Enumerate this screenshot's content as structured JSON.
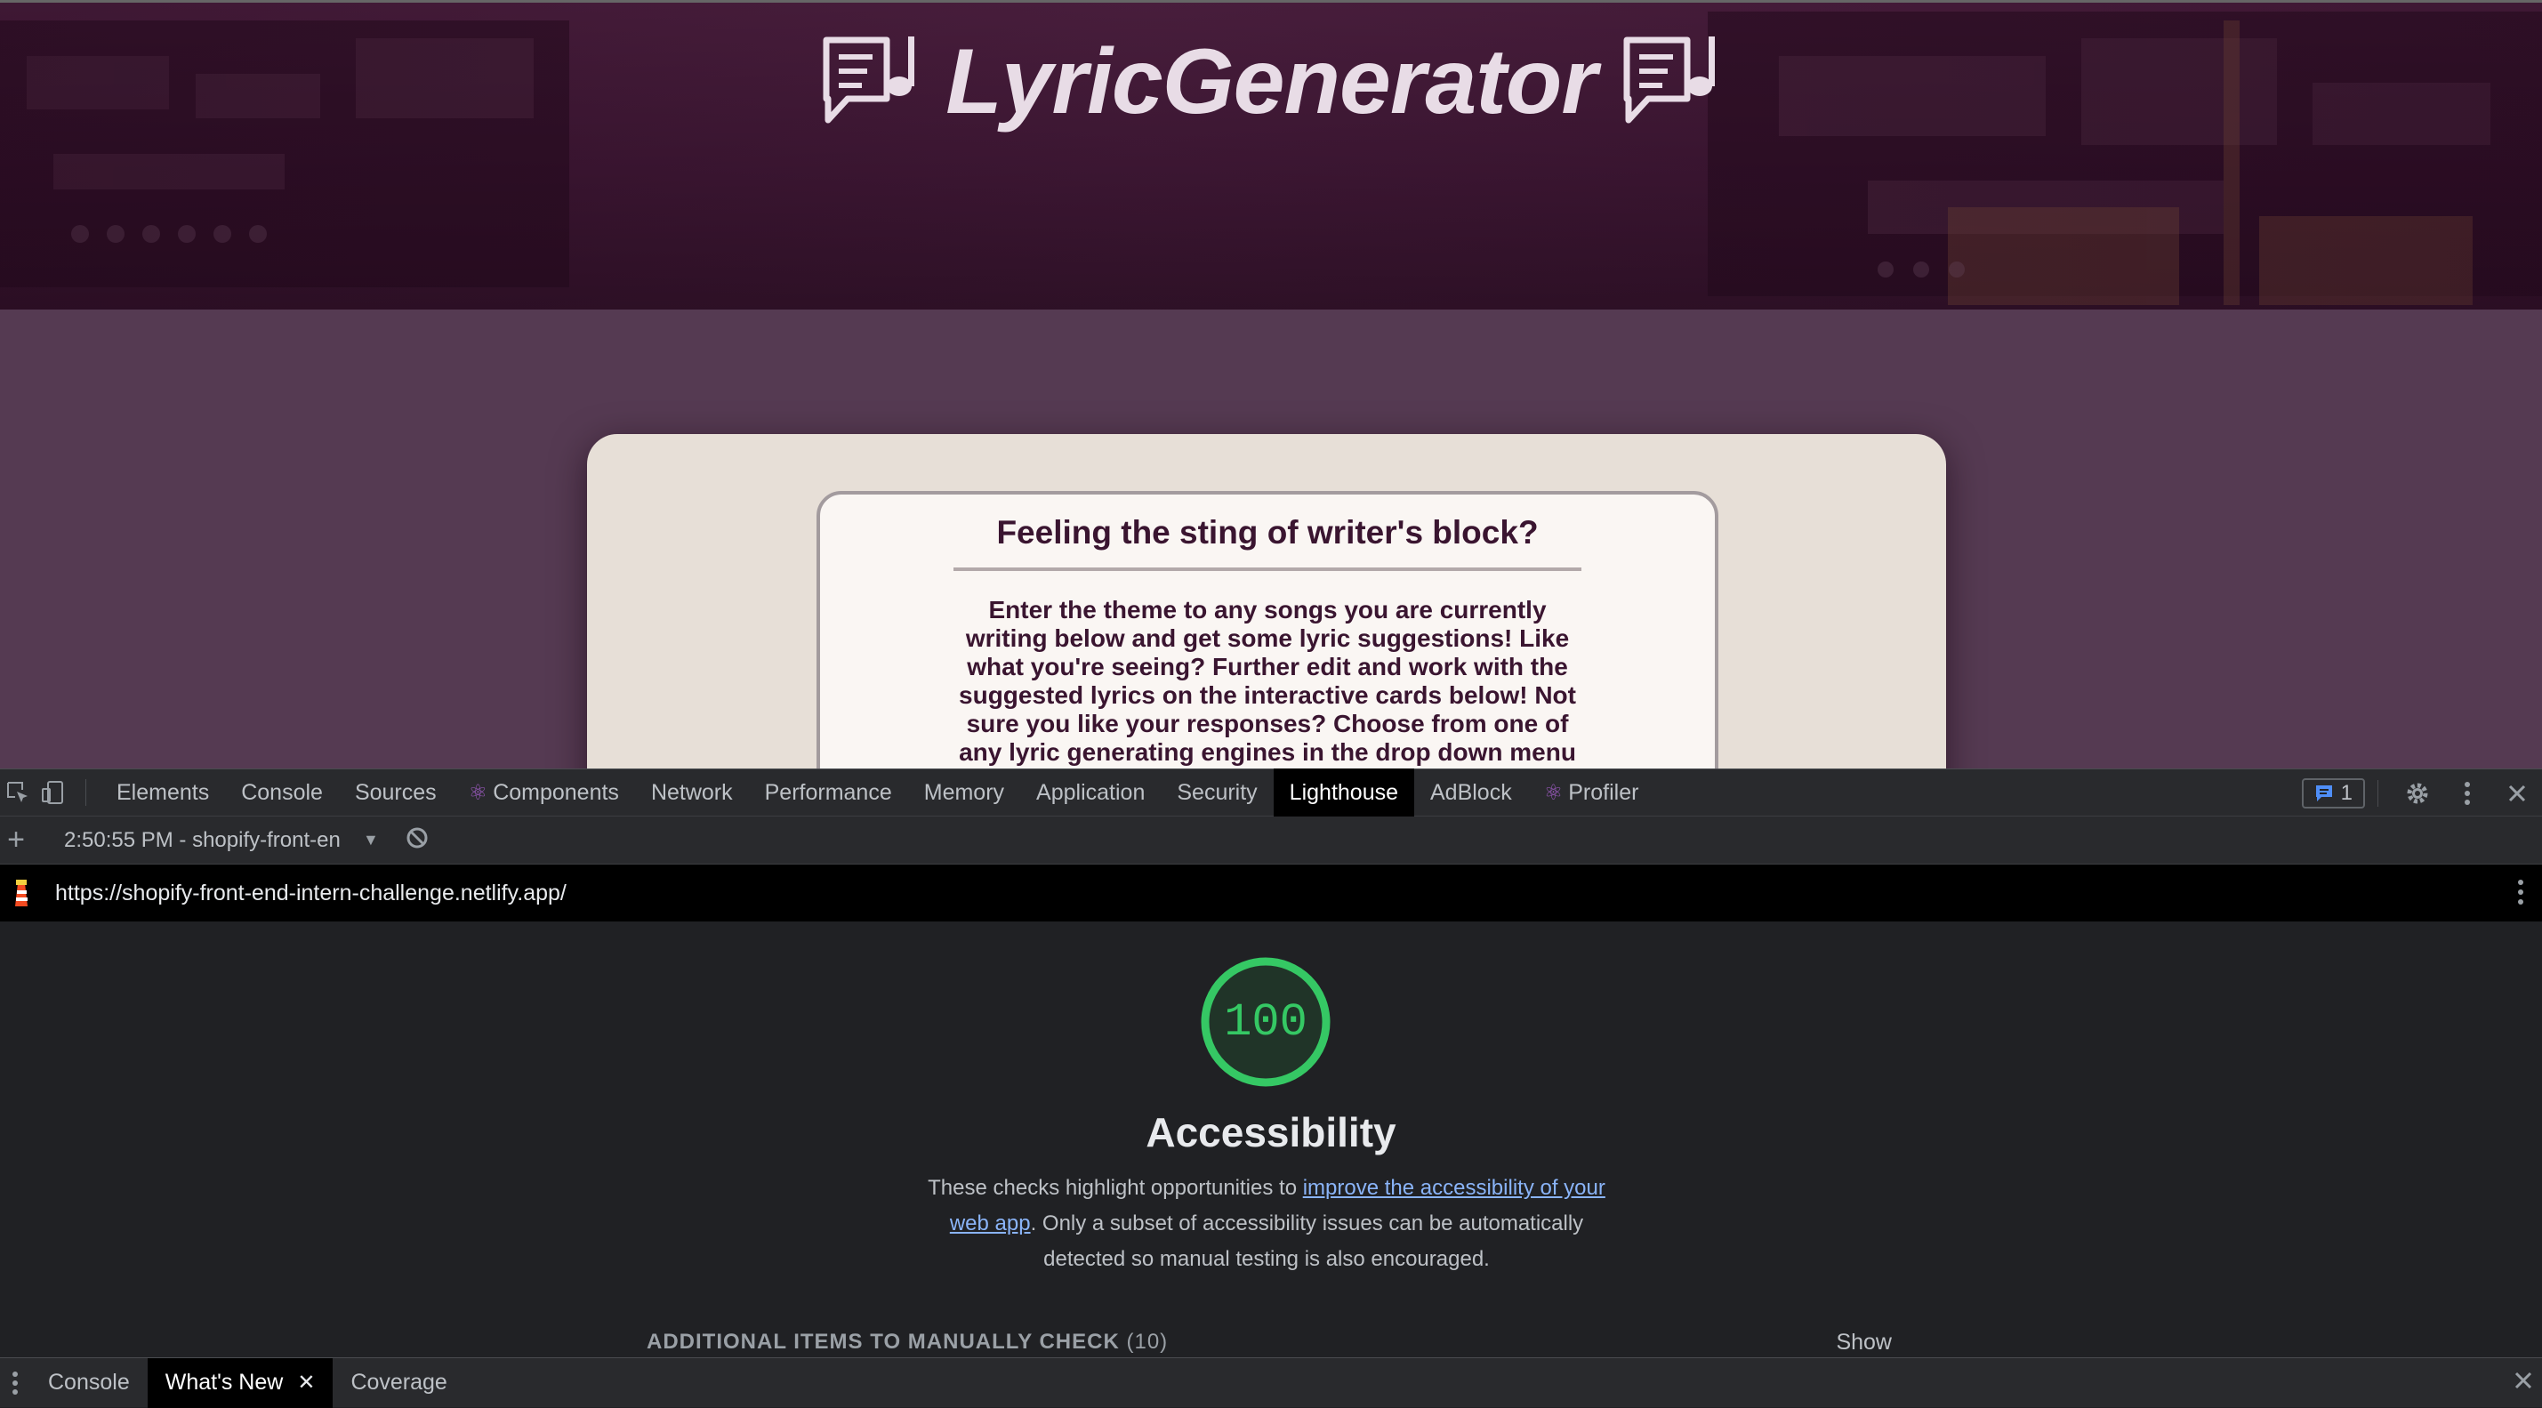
{
  "site": {
    "brand": "LyricGenerator",
    "card": {
      "heading": "Feeling the sting of writer's block?",
      "body": "Enter the theme to any songs you are currently writing below and get some lyric suggestions! Like what you're seeing? Further edit and work with the suggested lyrics on the interactive cards below! Not sure you like your responses? Choose from one of any lyric generating engines in the drop down menu"
    }
  },
  "devtools": {
    "tabs": [
      {
        "label": "Elements"
      },
      {
        "label": "Console"
      },
      {
        "label": "Sources"
      },
      {
        "label": "Components",
        "icon": "react-icon"
      },
      {
        "label": "Network"
      },
      {
        "label": "Performance"
      },
      {
        "label": "Memory"
      },
      {
        "label": "Application"
      },
      {
        "label": "Security"
      },
      {
        "label": "Lighthouse",
        "active": true
      },
      {
        "label": "AdBlock"
      },
      {
        "label": "Profiler",
        "icon": "react-icon"
      }
    ],
    "issues_count": "1",
    "report_select": "2:50:55 PM - shopify-front-en",
    "url": "https://shopify-front-end-intern-challenge.netlify.app/",
    "score": "100",
    "score_fraction": 1.0,
    "score_color": "#35c864",
    "category": "Accessibility",
    "desc_before": "These checks highlight opportunities to ",
    "desc_link": "improve the accessibility of your web app",
    "desc_after": ". Only a subset of accessibility issues can be automatically detected so manual testing is also encouraged.",
    "manual_label": "ADDITIONAL ITEMS TO MANUALLY CHECK",
    "manual_count": "(10)",
    "show_label": "Show",
    "drawer_tabs": [
      {
        "label": "Console"
      },
      {
        "label": "What's New",
        "active": true,
        "closable": true
      },
      {
        "label": "Coverage"
      }
    ]
  }
}
